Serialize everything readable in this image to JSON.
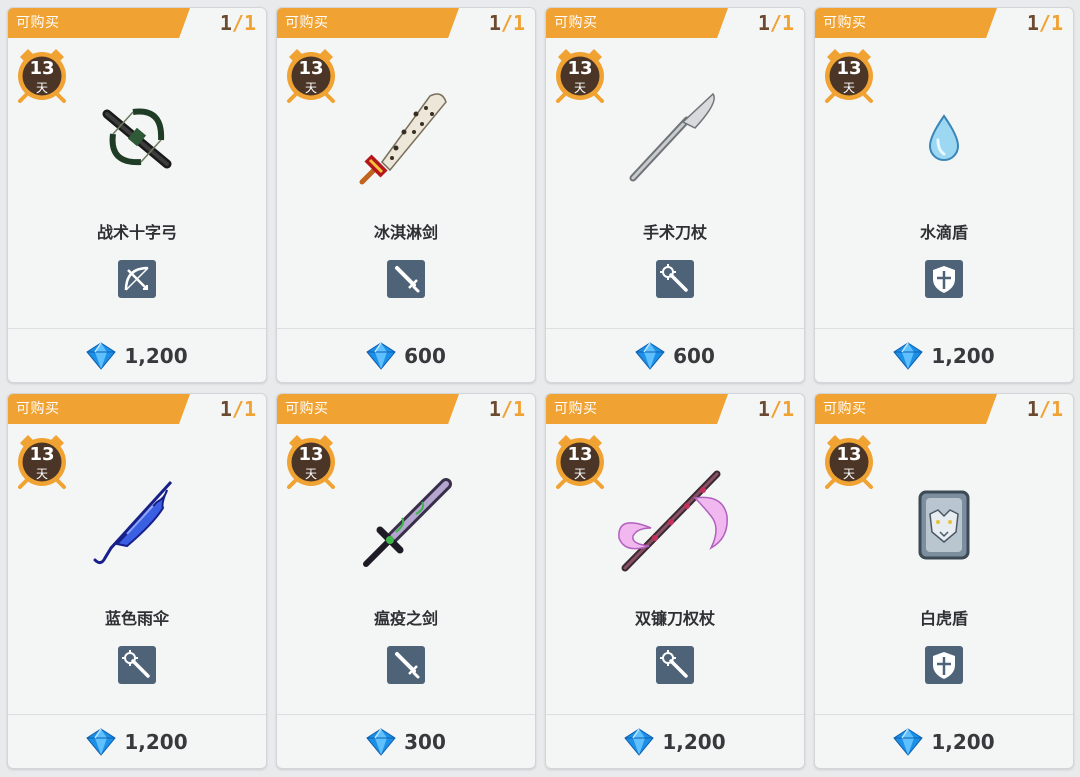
{
  "colors": {
    "banner": "#f0a232",
    "stock_current": "#6b4a30",
    "clock_face": "#4a3526",
    "type_badge": "#4e6378",
    "gem": "#1c8fe6"
  },
  "items": [
    {
      "badge": "可购买",
      "stock_current": "1",
      "stock_sep": "/",
      "stock_max": "1",
      "days": "13",
      "days_unit": "天",
      "name": "战术十字弓",
      "type_icon": "bow-icon",
      "art_icon": "crossbow-icon",
      "price": "1,200"
    },
    {
      "badge": "可购买",
      "stock_current": "1",
      "stock_sep": "/",
      "stock_max": "1",
      "days": "13",
      "days_unit": "天",
      "name": "冰淇淋剑",
      "type_icon": "sword-icon",
      "art_icon": "ice-cream-sword-icon",
      "price": "600"
    },
    {
      "badge": "可购买",
      "stock_current": "1",
      "stock_sep": "/",
      "stock_max": "1",
      "days": "13",
      "days_unit": "天",
      "name": "手术刀杖",
      "type_icon": "staff-icon",
      "art_icon": "scalpel-staff-icon",
      "price": "600"
    },
    {
      "badge": "可购买",
      "stock_current": "1",
      "stock_sep": "/",
      "stock_max": "1",
      "days": "13",
      "days_unit": "天",
      "name": "水滴盾",
      "type_icon": "shield-icon",
      "art_icon": "water-drop-icon",
      "price": "1,200"
    },
    {
      "badge": "可购买",
      "stock_current": "1",
      "stock_sep": "/",
      "stock_max": "1",
      "days": "13",
      "days_unit": "天",
      "name": "蓝色雨伞",
      "type_icon": "staff-icon",
      "art_icon": "blue-umbrella-icon",
      "price": "1,200"
    },
    {
      "badge": "可购买",
      "stock_current": "1",
      "stock_sep": "/",
      "stock_max": "1",
      "days": "13",
      "days_unit": "天",
      "name": "瘟疫之剑",
      "type_icon": "sword-icon",
      "art_icon": "plague-sword-icon",
      "price": "300"
    },
    {
      "badge": "可购买",
      "stock_current": "1",
      "stock_sep": "/",
      "stock_max": "1",
      "days": "13",
      "days_unit": "天",
      "name": "双镰刀权杖",
      "type_icon": "staff-icon",
      "art_icon": "double-scythe-icon",
      "price": "1,200"
    },
    {
      "badge": "可购买",
      "stock_current": "1",
      "stock_sep": "/",
      "stock_max": "1",
      "days": "13",
      "days_unit": "天",
      "name": "白虎盾",
      "type_icon": "shield-icon",
      "art_icon": "white-tiger-shield-icon",
      "price": "1,200"
    }
  ]
}
